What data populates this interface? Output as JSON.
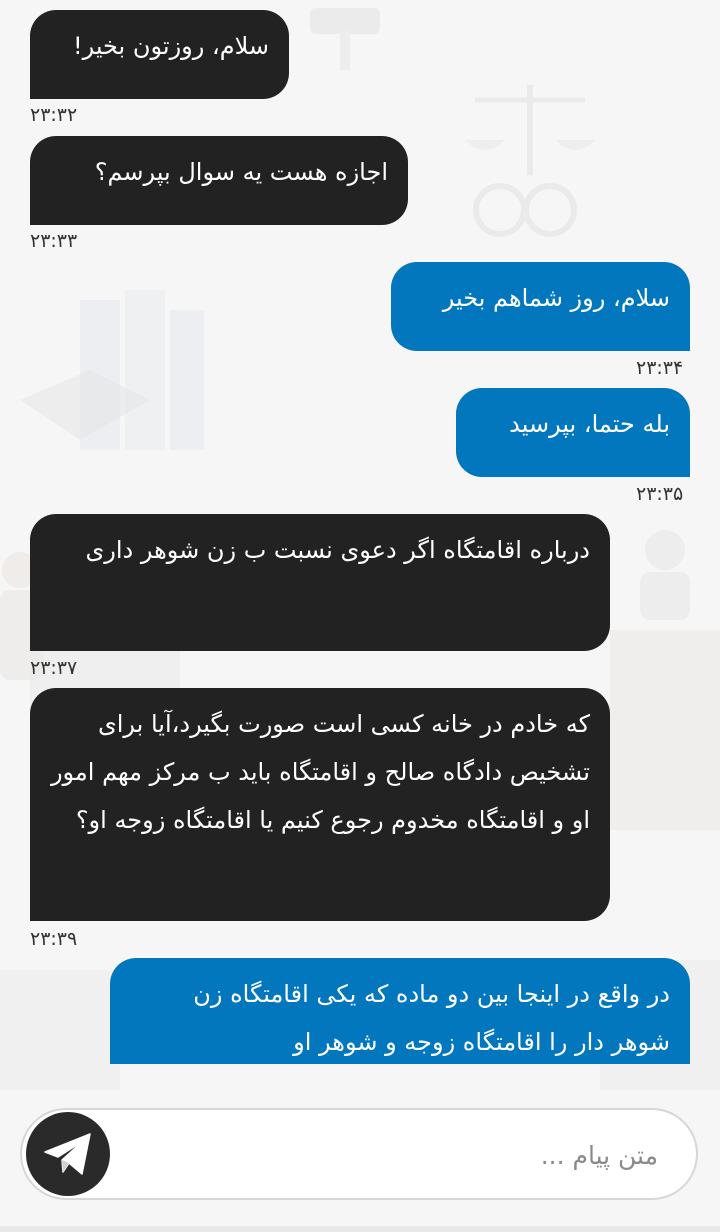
{
  "theme": {
    "incoming_color": "#222222",
    "outgoing_color": "#0277bd",
    "background": "#f6f6f7"
  },
  "messages": [
    {
      "direction": "incoming",
      "text": "سلام، روزتون بخیر!",
      "time": "۲۳:۳۲"
    },
    {
      "direction": "incoming",
      "text": "اجازه هست یه سوال بپرسم؟",
      "time": "۲۳:۳۳"
    },
    {
      "direction": "outgoing",
      "text": "سلام، روز شماهم بخیر",
      "time": "۲۳:۳۴"
    },
    {
      "direction": "outgoing",
      "text": "بله حتما، بپرسید",
      "time": "۲۳:۳۵"
    },
    {
      "direction": "incoming",
      "text": "درباره اقامتگاه اگر دعوی نسبت ب زن شوهر داری",
      "time": "۲۳:۳۷"
    },
    {
      "direction": "incoming",
      "text": "که خادم در خانه کسی است صورت بگیرد،آیا برای تشخیص دادگاه صالح و اقامتگاه باید ب مرکز مهم امور او و اقامتگاه مخدوم رجوع کنیم یا اقامتگاه زوجه او؟",
      "time": "۲۳:۳۹"
    },
    {
      "direction": "outgoing",
      "text": "در واقع در اینجا بین دو ماده  که یکی اقامتگاه زن شوهر دار را اقامتگاه زوجه و شوهر او",
      "time": ""
    }
  ],
  "composer": {
    "placeholder": "متن پیام ...",
    "value": "",
    "send_icon": "send-icon"
  }
}
